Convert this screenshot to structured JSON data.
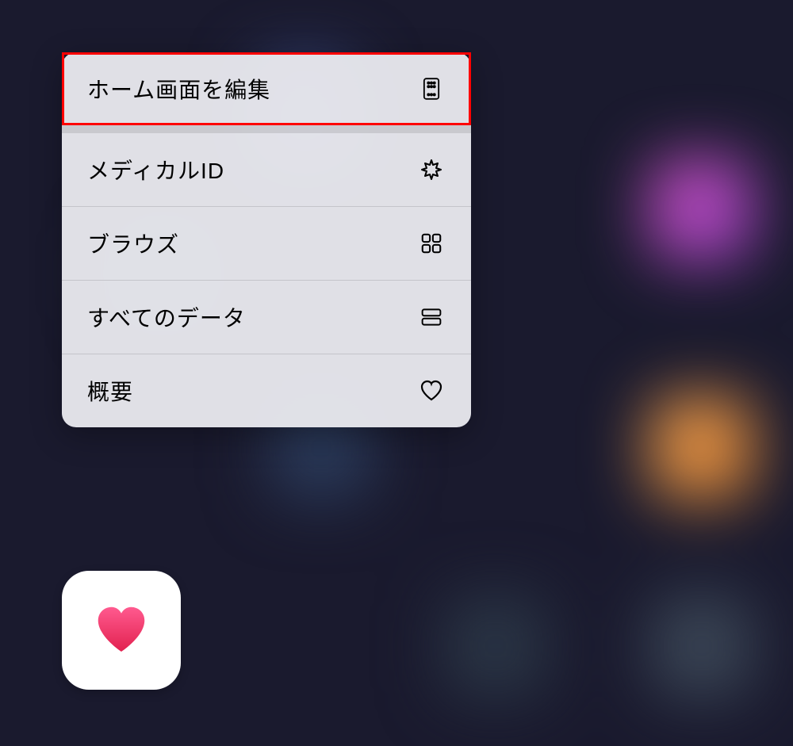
{
  "menu": {
    "items": [
      {
        "label": "ホーム画面を編集",
        "icon": "edit-home-icon",
        "highlighted": true
      },
      {
        "label": "メディカルID",
        "icon": "medical-id-icon",
        "highlighted": false
      },
      {
        "label": "ブラウズ",
        "icon": "browse-icon",
        "highlighted": false
      },
      {
        "label": "すべてのデータ",
        "icon": "all-data-icon",
        "highlighted": false
      },
      {
        "label": "概要",
        "icon": "summary-icon",
        "highlighted": false
      }
    ]
  },
  "app": {
    "name": "health-app",
    "icon": "heart-icon"
  },
  "colors": {
    "highlight": "#ff0000",
    "menu_bg": "rgba(235,235,240,0.95)",
    "heart_top": "#ff5a8f",
    "heart_bottom": "#e2214f"
  }
}
